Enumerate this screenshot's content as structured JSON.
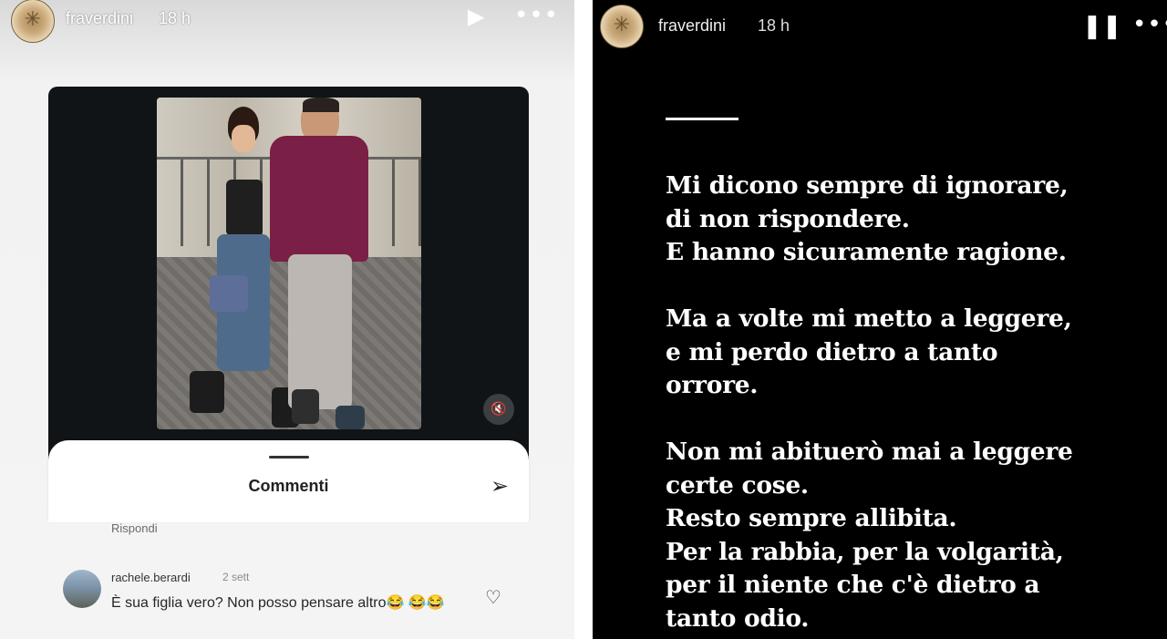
{
  "left": {
    "username": "fraverdini",
    "time": "18 h",
    "play_icon": "play-icon",
    "more_icon": "more-icon",
    "mute_icon": "mute-icon",
    "sheet_title": "Commenti",
    "send_icon": "send-icon",
    "reply_label": "Rispondi",
    "comment": {
      "user": "rachele.berardi",
      "ago": "2 sett",
      "text": "È sua figlia vero? Non posso pensare altro😂 😂😂"
    },
    "heart_icon": "heart-icon"
  },
  "right": {
    "username": "fraverdini",
    "time": "18 h",
    "pause_icon": "pause-icon",
    "more_icon": "more-icon",
    "paragraphs": [
      "Mi dicono sempre di ignorare,\ndi non rispondere.\nE hanno sicuramente ragione.",
      "Ma a volte mi metto a leggere,\ne mi perdo dietro a tanto\norrore.",
      "Non mi abituerò mai a leggere\ncerte cose.\nResto sempre allibita.\nPer la rabbia, per la volgarità,\nper il niente che c'è dietro a\ntanto odio."
    ]
  }
}
